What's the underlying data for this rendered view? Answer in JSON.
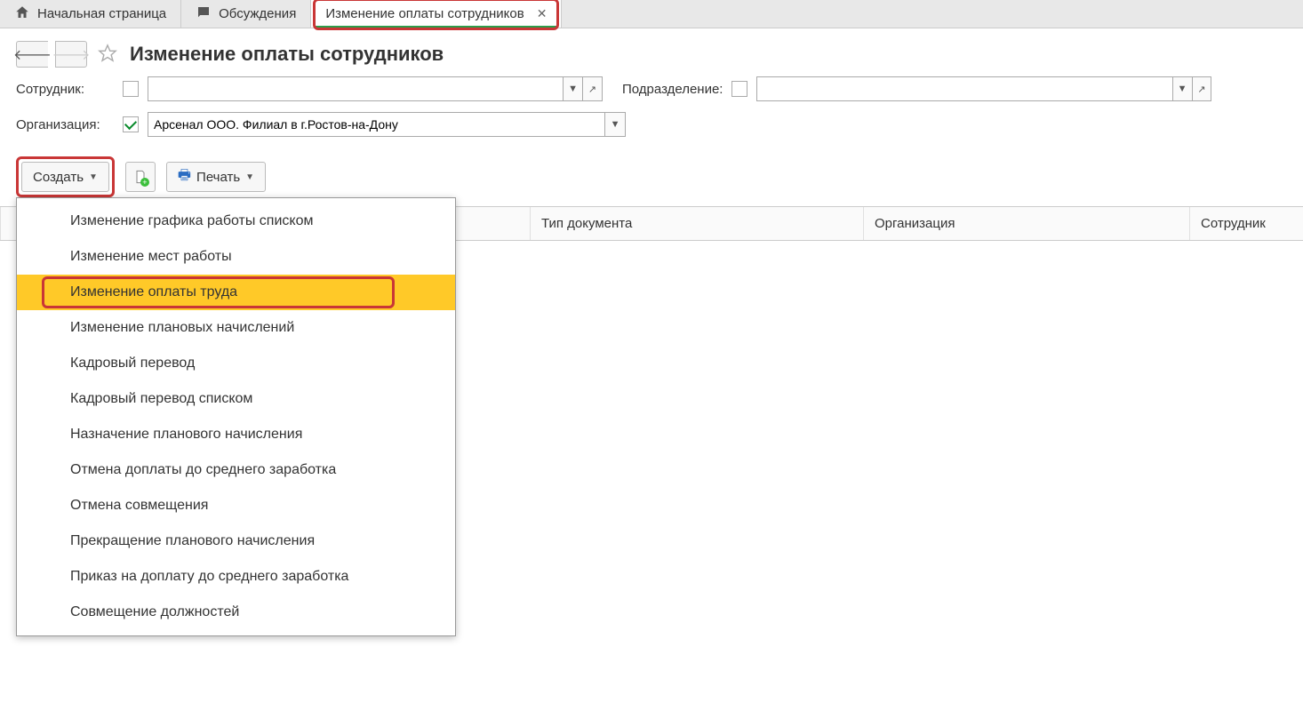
{
  "tabs": [
    {
      "label": "Начальная страница",
      "icon": "home"
    },
    {
      "label": "Обсуждения",
      "icon": "chat"
    },
    {
      "label": "Изменение оплаты сотрудников",
      "closeable": true,
      "highlighted": true
    }
  ],
  "page_title": "Изменение оплаты сотрудников",
  "filters": {
    "employee": {
      "label": "Сотрудник:",
      "checked": false,
      "value": ""
    },
    "department": {
      "label": "Подразделение:",
      "checked": false,
      "value": ""
    },
    "organization": {
      "label": "Организация:",
      "checked": true,
      "value": "Арсенал ООО. Филиал в г.Ростов-на-Дону"
    }
  },
  "toolbar": {
    "create_label": "Создать",
    "print_label": "Печать"
  },
  "create_menu": [
    "Изменение графика работы списком",
    "Изменение мест работы",
    "Изменение оплаты труда",
    "Изменение плановых начислений",
    "Кадровый перевод",
    "Кадровый перевод списком",
    "Назначение планового начисления",
    "Отмена доплаты до среднего заработка",
    "Отмена совмещения",
    "Прекращение планового начисления",
    "Приказ на доплату до среднего заработка",
    "Совмещение должностей"
  ],
  "create_menu_selected_index": 2,
  "table_columns": [
    "Тип документа",
    "Организация",
    "Сотрудник"
  ]
}
